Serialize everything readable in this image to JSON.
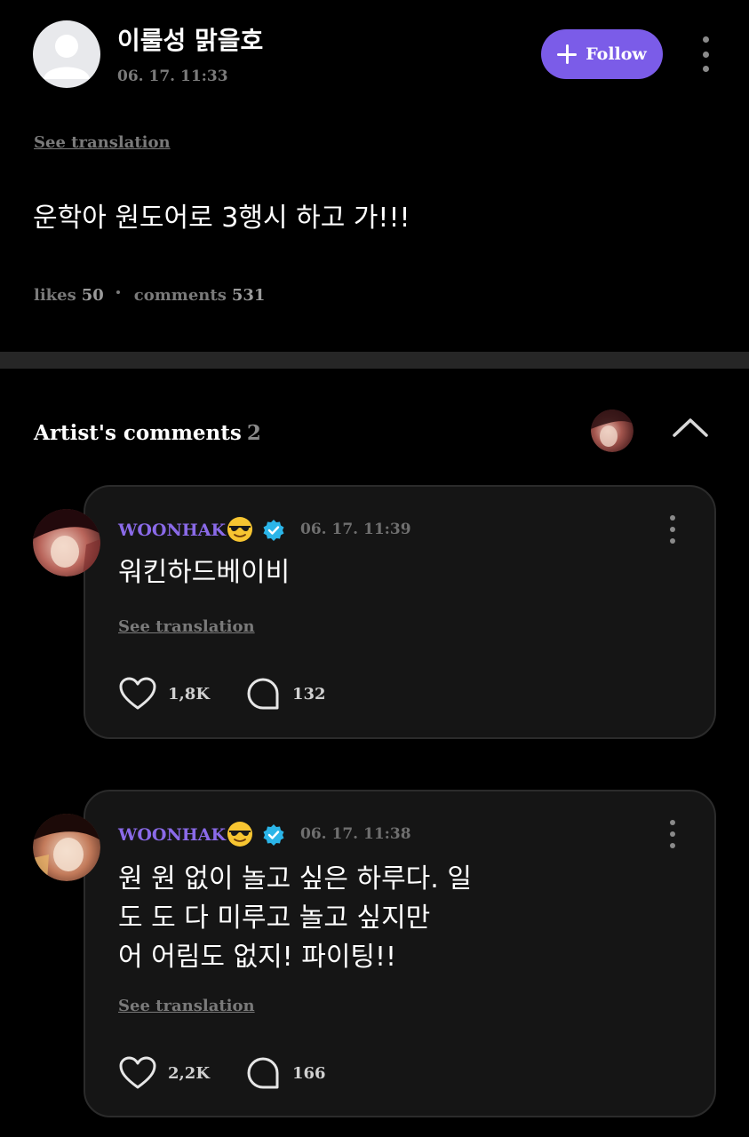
{
  "post": {
    "author": "이룰성 맑을호",
    "time": "06. 17. 11:33",
    "follow_label": "Follow",
    "see_translation": "See translation",
    "body": "운학아 원도어로 3행시 하고 가!!!",
    "likes_label": "likes",
    "likes_count": "50",
    "comments_label": "comments",
    "comments_count": "531"
  },
  "artist_comments": {
    "title": "Artist's comments",
    "count": "2",
    "items": [
      {
        "name": "WOONHAK",
        "emoji": "smiling-face-with-sunglasses",
        "time": "06. 17. 11:39",
        "text": "워킨하드베이비",
        "see_translation": "See translation",
        "likes": "1,8K",
        "replies": "132"
      },
      {
        "name": "WOONHAK",
        "emoji": "smiling-face-with-sunglasses",
        "time": "06. 17. 11:38",
        "text": "원 원 없이 놀고 싶은 하루다. 일\n도 도 다 미루고 놀고 싶지만\n어 어림도 없지! 파이팅!!",
        "see_translation": "See translation",
        "likes": "2,2K",
        "replies": "166"
      }
    ]
  },
  "colors": {
    "background": "#000000",
    "card": "#151515",
    "accent": "#7b5ce8",
    "artist_name": "#8a6ae8",
    "verified": "#2bb5e8",
    "muted": "#7a7a7a"
  }
}
